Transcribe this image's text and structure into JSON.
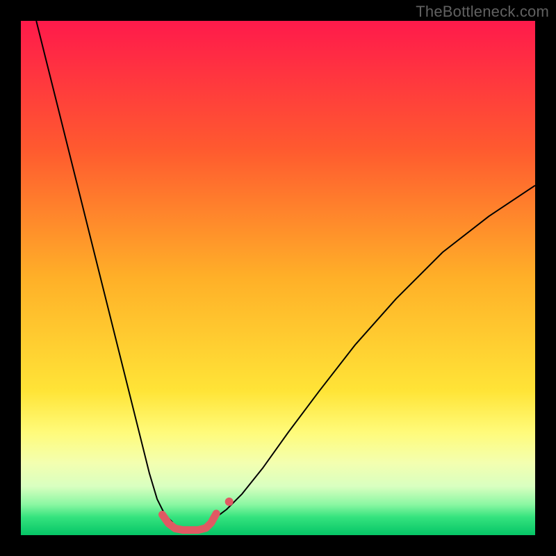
{
  "watermark": "TheBottleneck.com",
  "chart_data": {
    "type": "line",
    "title": "",
    "xlabel": "",
    "ylabel": "",
    "xlim": [
      0,
      100
    ],
    "ylim": [
      0,
      100
    ],
    "grid": false,
    "legend": false,
    "background": {
      "gradient_stops": [
        {
          "offset": 0.0,
          "color": "#ff1a4b"
        },
        {
          "offset": 0.25,
          "color": "#ff5a2f"
        },
        {
          "offset": 0.5,
          "color": "#ffb028"
        },
        {
          "offset": 0.72,
          "color": "#ffe437"
        },
        {
          "offset": 0.8,
          "color": "#fffb7a"
        },
        {
          "offset": 0.86,
          "color": "#f3ffb0"
        },
        {
          "offset": 0.905,
          "color": "#d9ffc0"
        },
        {
          "offset": 0.94,
          "color": "#8cf7a3"
        },
        {
          "offset": 0.965,
          "color": "#35e37e"
        },
        {
          "offset": 1.0,
          "color": "#05c566"
        }
      ]
    },
    "series": [
      {
        "name": "left-curve",
        "stroke": "#000000",
        "stroke_width": 2,
        "x": [
          3,
          5,
          7,
          9,
          11,
          13,
          15,
          17,
          19,
          21,
          23,
          25,
          26.5,
          28,
          29.5
        ],
        "y": [
          100,
          92,
          84,
          76,
          68,
          60,
          52,
          44,
          36,
          28,
          20,
          12,
          7,
          4,
          2.5
        ]
      },
      {
        "name": "right-curve",
        "stroke": "#000000",
        "stroke_width": 2,
        "x": [
          38,
          40,
          43,
          47,
          52,
          58,
          65,
          73,
          82,
          91,
          100
        ],
        "y": [
          3.5,
          5,
          8,
          13,
          20,
          28,
          37,
          46,
          55,
          62,
          68
        ]
      },
      {
        "name": "marker-band",
        "stroke": "#e05a63",
        "stroke_width": 11,
        "linecap": "round",
        "x": [
          27.5,
          28.7,
          30.0,
          31.5,
          33.0,
          34.5,
          36.0,
          37.0,
          38.0
        ],
        "y": [
          4.0,
          2.3,
          1.3,
          1.0,
          1.0,
          1.0,
          1.4,
          2.4,
          4.2
        ]
      },
      {
        "name": "right-dot",
        "type": "scatter",
        "fill": "#e05a63",
        "radius": 6,
        "x": [
          40.5
        ],
        "y": [
          6.5
        ]
      }
    ]
  }
}
